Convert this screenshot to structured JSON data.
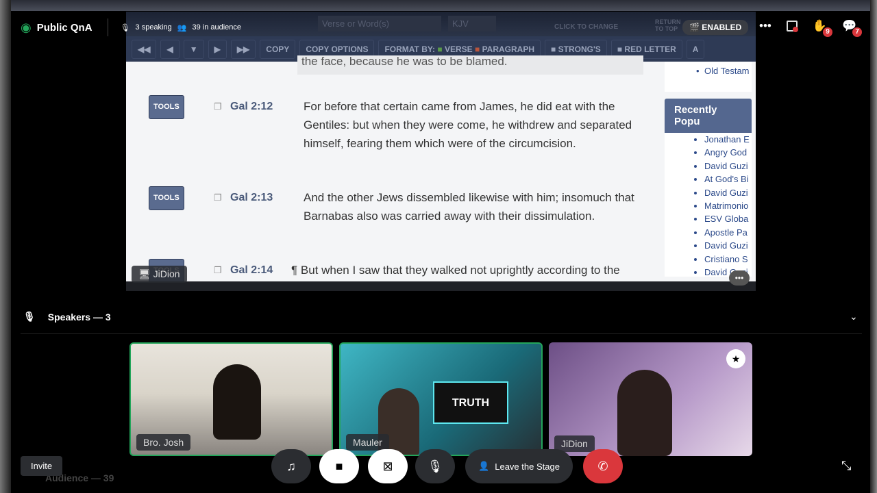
{
  "header": {
    "title": "Public QnA",
    "speaking": "3 speaking",
    "audience": "39 in audience"
  },
  "top_right": {
    "hand_badge": "9",
    "chat_badge": "7"
  },
  "stream": {
    "search_placeholder": "Verse or Word(s)",
    "version": "KJV",
    "click_to_change": "CLICK TO CHANGE",
    "return_top": "RETURN TO TOP",
    "enabled": "ENABLED",
    "toolbar": [
      "COPY",
      "COPY OPTIONS",
      "FORMAT BY:",
      "VERSE",
      "PARAGRAPH",
      "STRONG'S",
      "RED LETTER",
      "A"
    ],
    "prev_text": "the face, because he was to be blamed.",
    "verses": [
      {
        "tools": "TOOLS",
        "ref": "Gal 2:12",
        "text": "For before that certain came from James, he did eat with the Gentiles: but when they were come, he withdrew and separated himself, fearing them which were of the circumcision."
      },
      {
        "tools": "TOOLS",
        "ref": "Gal 2:13",
        "text": "And the other Jews dissembled likewise with him; insomuch that Barnabas also was carried away with their dissimulation."
      },
      {
        "tools": "TOOLS",
        "ref": "Gal 2:14",
        "text": "¶ But when I saw that they walked not uprightly according to the truth of the gospel, I said unto Peter before them"
      }
    ],
    "sidebar": {
      "top_item": "Old Testam",
      "heading": "Recently Popu",
      "items": [
        "Jonathan E",
        "Angry God",
        "David Guzi",
        "At God's Bi",
        "David Guzi",
        "Matrimonio",
        "ESV Globa",
        "Apostle Pa",
        "David Guzi",
        "Cristiano S",
        "David Guzi"
      ]
    },
    "streamer": "JiDion"
  },
  "speakers": {
    "label": "Speakers — 3",
    "tiles": [
      {
        "name": "Bro. Josh"
      },
      {
        "name": "Mauler"
      },
      {
        "name": "JiDion"
      }
    ],
    "sign_text": "TRUTH"
  },
  "controls": {
    "invite": "Invite",
    "leave": "Leave the Stage",
    "audience": "Audience — 39"
  },
  "colors": {
    "accent_green": "#23a55a",
    "danger": "#da373c",
    "toolbar": "#2e3a55"
  }
}
